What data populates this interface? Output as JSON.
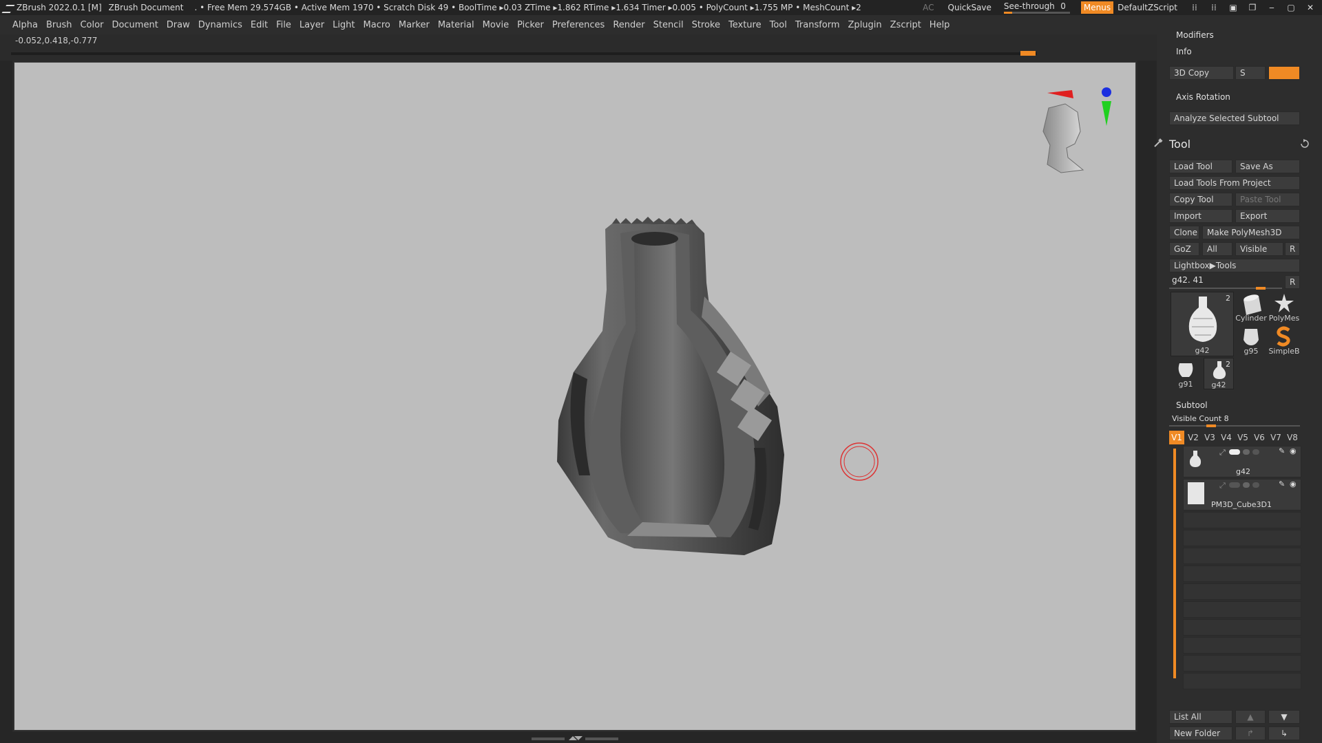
{
  "titlebar": {
    "app": "ZBrush 2022.0.1 [M]",
    "document": "ZBrush Document",
    "stats": ". • Free Mem 29.574GB • Active Mem 1970 • Scratch Disk 49 •  BoolTime ▸0.03 ZTime ▸1.862 RTime ▸1.634 Timer ▸0.005 • PolyCount ▸1.755 MP  • MeshCount ▸2",
    "ac": "AC",
    "quicksave": "QuickSave",
    "see_through_label": "See-through",
    "see_through_value": "0",
    "see_through_level": 0.0,
    "menus": "Menus",
    "script": "DefaultZScript"
  },
  "menubar": [
    "Alpha",
    "Brush",
    "Color",
    "Document",
    "Draw",
    "Dynamics",
    "Edit",
    "File",
    "Layer",
    "Light",
    "Macro",
    "Marker",
    "Material",
    "Movie",
    "Picker",
    "Preferences",
    "Render",
    "Stencil",
    "Stroke",
    "Texture",
    "Tool",
    "Transform",
    "Zplugin",
    "Zscript",
    "Help"
  ],
  "coords": "-0.052,0.418,-0.777",
  "tray": {
    "modifiers": "Modifiers",
    "info": "Info",
    "copy3d": "3D Copy",
    "s": "S",
    "axis_rotation": "Axis Rotation",
    "analyze": "Analyze Selected Subtool",
    "tool_title": "Tool",
    "load_tool": "Load Tool",
    "save_as": "Save As",
    "load_from_project": "Load Tools From Project",
    "copy_tool": "Copy Tool",
    "paste_tool": "Paste Tool",
    "import": "Import",
    "export": "Export",
    "clone": "Clone",
    "make_polymesh": "Make PolyMesh3D",
    "goz": "GoZ",
    "all": "All",
    "visible": "Visible",
    "r": "R",
    "lightbox_tools": "Lightbox▶Tools",
    "current_tool": "g42. 41",
    "current_tool_r": "R",
    "thumbs": {
      "main_label": "g42",
      "main_count": "2",
      "cylinder": "Cylinder",
      "polymesh": "PolyMes",
      "g95": "g95",
      "simpleb": "SimpleB",
      "g91": "g91",
      "g42b": "g42",
      "g42b_count": "2"
    },
    "subtool_title": "Subtool",
    "visible_count": "Visible Count 8",
    "vtabs": [
      "V1",
      "V2",
      "V3",
      "V4",
      "V5",
      "V6",
      "V7",
      "V8"
    ],
    "subtools": [
      "g42",
      "PM3D_Cube3D1"
    ],
    "list_all": "List All",
    "new_folder": "New Folder"
  }
}
